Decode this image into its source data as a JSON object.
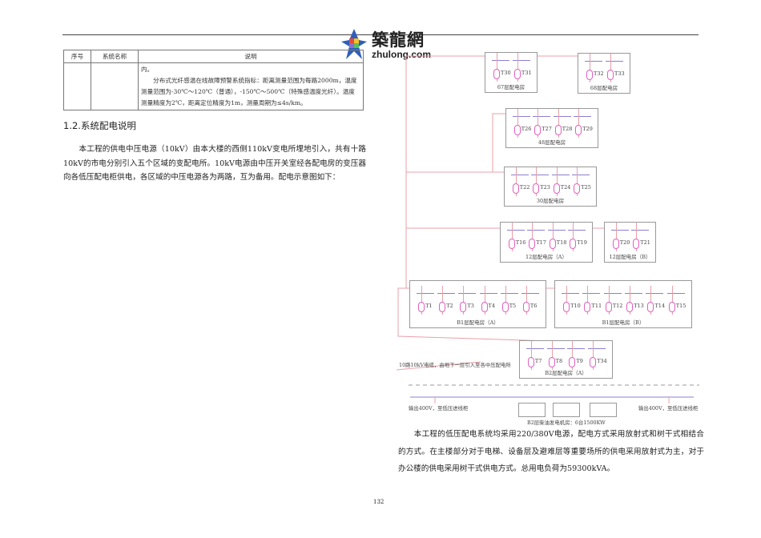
{
  "logo": {
    "cn": "築龍網",
    "en": "zhulong.com"
  },
  "table": {
    "headers": [
      "序号",
      "系统名称",
      "说明"
    ],
    "row": {
      "no": "",
      "name": "",
      "desc_lines": [
        "内。",
        "　　分布式光纤感温在线故障预警系统指标：距离测量范围为每路2000m，温度测量范围为-30℃～120℃（普通），-150℃～500℃（特殊感温度光纤）。温度测量精度为2℃，距离定位精度为1m，测量周期为≤4s/km。"
      ]
    }
  },
  "section": {
    "heading": "1.2.系统配电说明",
    "para1": "　　本工程的供电中压电源（10kV）由本大楼的西侧110kV变电所埋地引入，共有十路10kV的市电分别引入五个区域的变配电所。10kV电源由中压开关室经各配电房的变压器向各低压配电柜供电，各区域的中压电源各为两路，互为备用。配电示意图如下：",
    "para2": "　　本工程的低压配电系统均采用220/380V电源，配电方式采用放射式和树干式相结合的方式。在主楼部分对于电梯、设备层及避难层等重要场所的供电采用放射式为主，对于办公楼的供电采用树干式供电方式。总用电负荷为59300kVA。"
  },
  "diagram": {
    "rooms": [
      {
        "label": "67层配电房",
        "transformers": [
          "T30",
          "T31"
        ]
      },
      {
        "label": "68层配电房",
        "transformers": [
          "T32",
          "T33"
        ]
      },
      {
        "label": "48层配电房",
        "transformers": [
          "T26",
          "T27",
          "T28",
          "T29"
        ]
      },
      {
        "label": "30层配电房",
        "transformers": [
          "T22",
          "T23",
          "T24",
          "T25"
        ]
      },
      {
        "label": "12层配电房（A）",
        "transformers": [
          "T16",
          "T17",
          "T18",
          "T19"
        ]
      },
      {
        "label": "12层配电房（B）",
        "transformers": [
          "T20",
          "T21"
        ]
      },
      {
        "label": "B1层配电房（A）",
        "transformers": [
          "T1",
          "T2",
          "T3",
          "T4",
          "T5",
          "T6"
        ]
      },
      {
        "label": "B1层配电房（B）",
        "transformers": [
          "T10",
          "T11",
          "T12",
          "T13",
          "T14",
          "T15"
        ]
      },
      {
        "label": "B2层配电房（A）",
        "transformers": [
          "T7",
          "T8",
          "T9",
          "T34"
        ]
      }
    ],
    "cable_note": "10路10kV电缆，由地下一层引入至各中压配电所",
    "out_left": "输出400V，至低压进线柜",
    "out_right": "输出400V，至低压进线柜",
    "generator_label": "B2层柴油发电机房：6台1500KW",
    "colors": {
      "feeder": "#e8a0a8",
      "bus": "#8b7fd0",
      "transformer": "#e060c0"
    }
  },
  "page_number": "132"
}
